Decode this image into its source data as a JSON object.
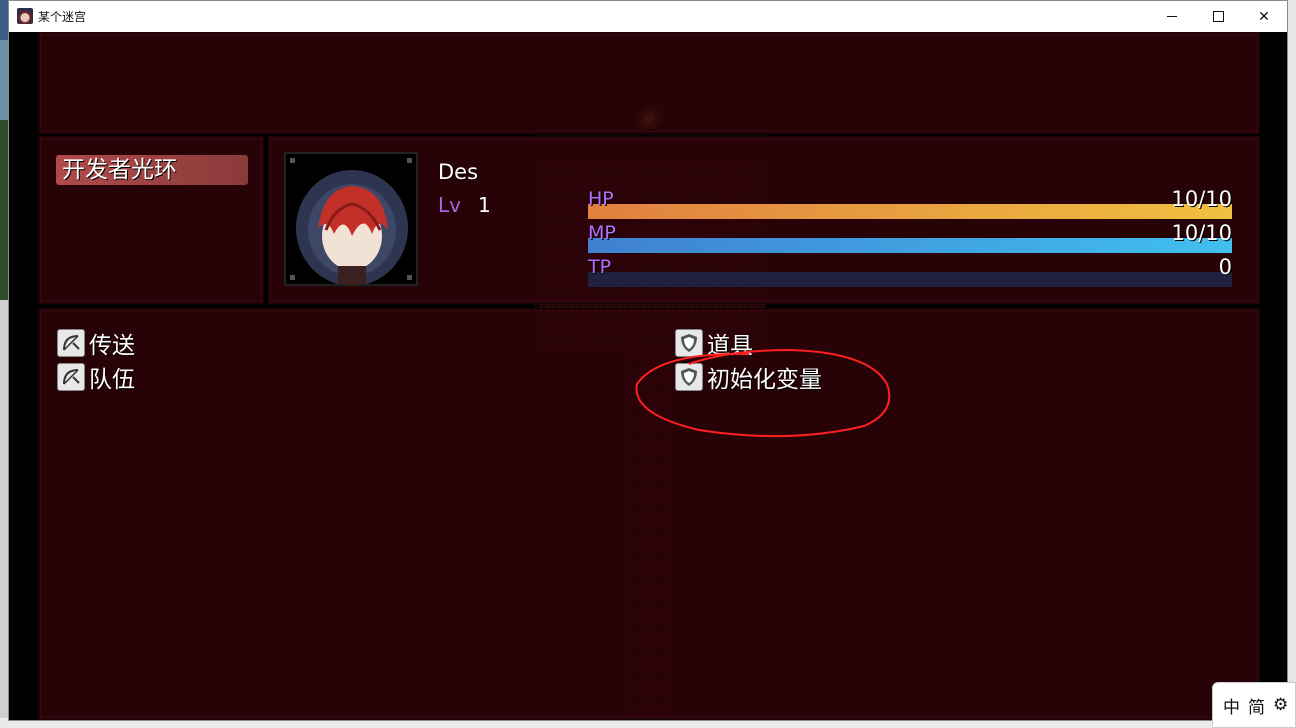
{
  "window": {
    "title": "某个迷宫"
  },
  "status": {
    "skill_label": "开发者光环",
    "actor_name": "Des",
    "level_label": "Lv",
    "level_value": "1",
    "hp": {
      "label": "HP",
      "value": "10/10",
      "fill": 1.0,
      "color": "#f0b040"
    },
    "mp": {
      "label": "MP",
      "value": "10/10",
      "fill": 1.0,
      "color": "#40b0f0"
    },
    "tp": {
      "label": "TP",
      "value": "0",
      "fill": 0.0,
      "color": "#202040"
    }
  },
  "commands": {
    "left": [
      {
        "label": "传送",
        "icon": "bow-icon"
      },
      {
        "label": "队伍",
        "icon": "bow-icon"
      }
    ],
    "right": [
      {
        "label": "道具",
        "icon": "shield-icon"
      },
      {
        "label": "初始化变量",
        "icon": "shield-icon"
      }
    ]
  },
  "ime": {
    "lang": "中",
    "mode": "简"
  },
  "colors": {
    "panel": "#2c0208",
    "annotation": "#ff2020"
  }
}
